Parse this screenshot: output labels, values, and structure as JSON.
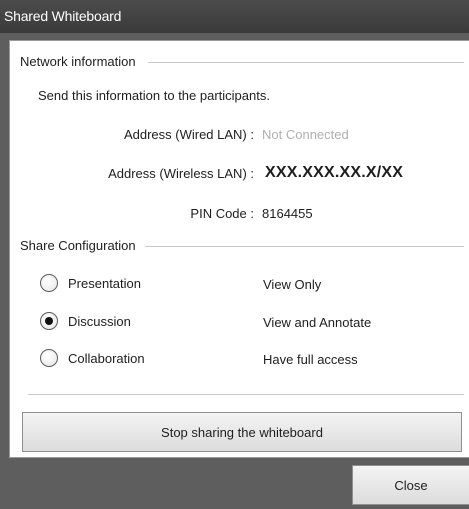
{
  "window": {
    "title": "Shared Whiteboard"
  },
  "network": {
    "section_title": "Network information",
    "instruction": "Send this information to the participants.",
    "wired_label": "Address (Wired LAN) :",
    "wired_value": "Not Connected",
    "wireless_label": "Address (Wireless LAN) :",
    "wireless_value": "XXX.XXX.XX.X/XX",
    "pin_label": "PIN Code :",
    "pin_value": "8164455"
  },
  "share": {
    "section_title": "Share Configuration",
    "options": [
      {
        "label": "Presentation",
        "description": "View Only",
        "selected": false
      },
      {
        "label": "Discussion",
        "description": "View and Annotate",
        "selected": true
      },
      {
        "label": "Collaboration",
        "description": "Have full access",
        "selected": false
      }
    ]
  },
  "buttons": {
    "stop_label": "Stop sharing the whiteboard",
    "close_label": "Close"
  }
}
